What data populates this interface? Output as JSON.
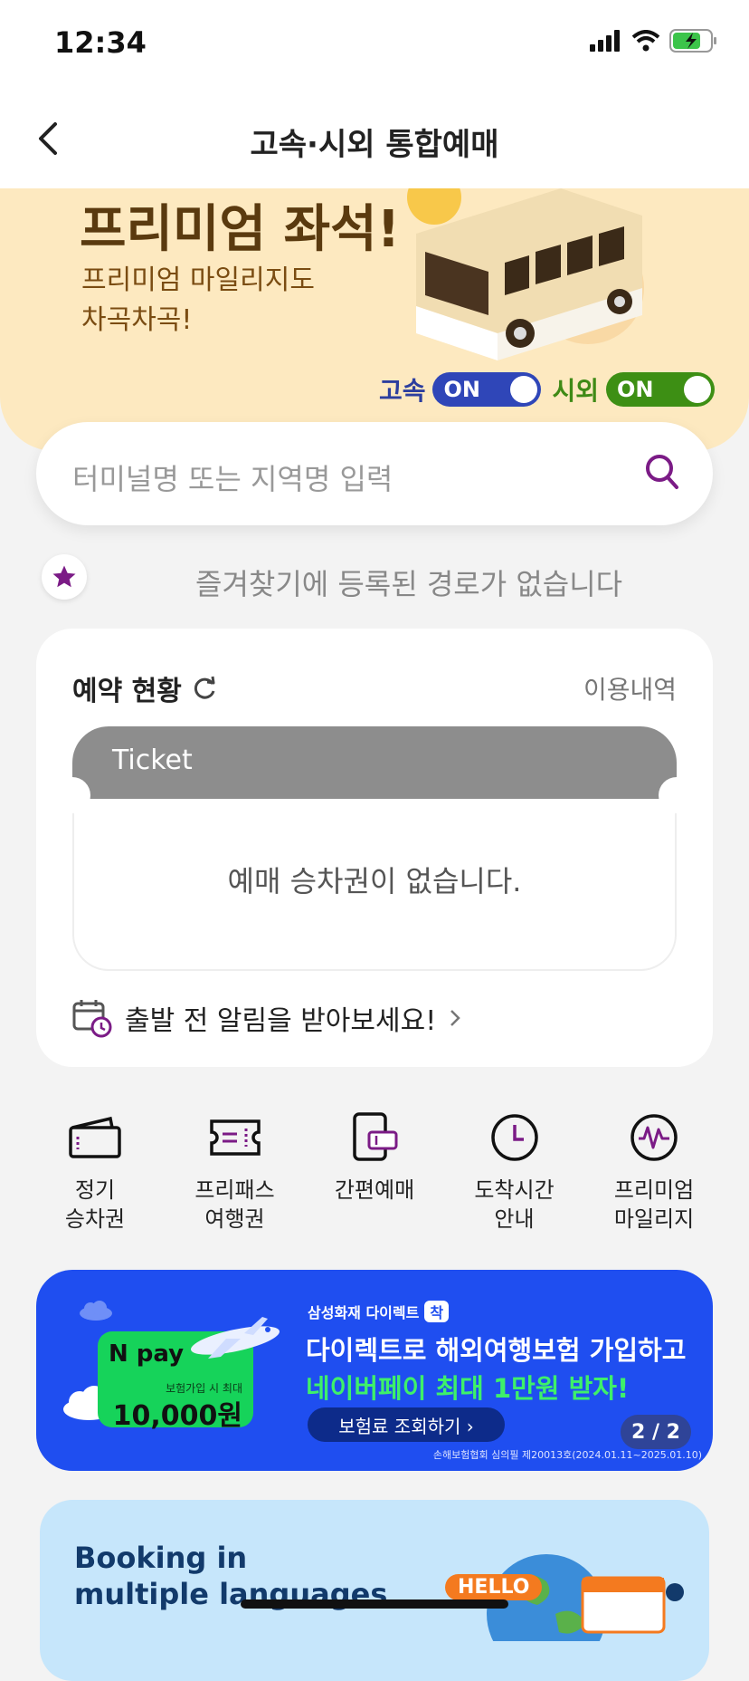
{
  "status_bar": {
    "time": "12:34"
  },
  "header": {
    "title": "고속·시외 통합예매"
  },
  "hero": {
    "title": "프리미엄 좌석!",
    "subtitle_line1": "프리미엄 마일리지도",
    "subtitle_line2": "차곡차곡!",
    "toggle_express_label": "고속",
    "toggle_express_state": "ON",
    "toggle_intercity_label": "시외",
    "toggle_intercity_state": "ON"
  },
  "search": {
    "placeholder": "터미널명 또는 지역명 입력"
  },
  "favorites": {
    "empty_text": "즐겨찾기에 등록된 경로가 없습니다"
  },
  "reservation": {
    "title": "예약 현황",
    "history_link": "이용내역",
    "ticket_label": "Ticket",
    "empty_text": "예매 승차권이 없습니다.",
    "alarm_text": "출발 전 알림을 받아보세요!"
  },
  "quick_menu": [
    {
      "label": "정기\n승차권",
      "icon": "wallet-icon"
    },
    {
      "label": "프리패스\n여행권",
      "icon": "ticket-icon"
    },
    {
      "label": "간편예매",
      "icon": "phone-ticket-icon"
    },
    {
      "label": "도착시간\n안내",
      "icon": "clock-icon"
    },
    {
      "label": "프리미엄\n마일리지",
      "icon": "mileage-icon"
    }
  ],
  "banner": {
    "brand": "삼성화재 다이렉트",
    "brand_badge": "착",
    "line1": "다이렉트로 해외여행보험 가입하고",
    "line2": "네이버페이 최대 1만원 받자!",
    "button_label": "보험료 조회하기 ›",
    "npay_logo": "N pay",
    "npay_small": "보험가입 시 최대",
    "npay_amount": "10,000원",
    "fine_print": "손해보험협회 심의필 제20013호(2024.01.11~2025.01.10)",
    "counter": "2 / 2"
  },
  "lang_card": {
    "title_line1": "Booking in",
    "title_line2": "multiple languages",
    "hello_badge": "HELLO"
  },
  "colors": {
    "accent_purple": "#7b1b86",
    "express_blue": "#2f46b8",
    "intercity_green": "#3d8f14",
    "banner_blue": "#1f4ef0"
  }
}
